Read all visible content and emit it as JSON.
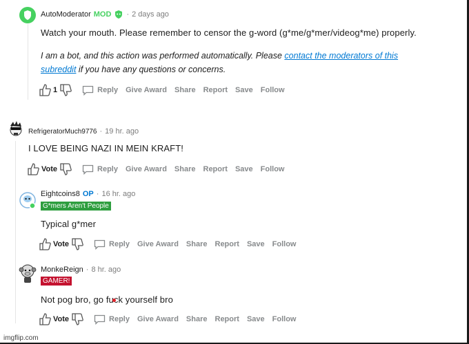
{
  "comments": [
    {
      "author": "AutoModerator",
      "badge": "MOD",
      "time": "2 days ago",
      "body": "Watch your mouth. Please remember to censor the g-word (g*me/g*mer/videog*me) properly.",
      "note_before": "I am a bot, and this action was performed automatically. Please ",
      "note_link": "contact the moderators of this subreddit",
      "note_after": " if you have any questions or concerns.",
      "vote": "1"
    },
    {
      "author": "RefrigeratorMuch9776",
      "time": "19 hr. ago",
      "body": "I LOVE BEING NAZI IN MEIN KRAFT!",
      "vote": "Vote"
    },
    {
      "author": "Eightcoins8",
      "badge": "OP",
      "time": "16 hr. ago",
      "flair": "G*mers Aren't People",
      "flair_color": "#2e9e3f",
      "body": "Typical g*mer",
      "vote": "Vote"
    },
    {
      "author": "MonkeReign",
      "time": "8 hr. ago",
      "flair": "GAMER!",
      "flair_color": "#c4122f",
      "body": "Not pog bro, go fuck yourself bro",
      "vote": "Vote"
    }
  ],
  "actions": {
    "reply": "Reply",
    "give_award": "Give Award",
    "share": "Share",
    "report": "Report",
    "save": "Save",
    "follow": "Follow"
  },
  "separator": "·",
  "watermark": "imgflip.com",
  "colors": {
    "mod": "#46d160",
    "op": "#0079d3",
    "link": "#0079d3",
    "muted": "#878a8c"
  }
}
